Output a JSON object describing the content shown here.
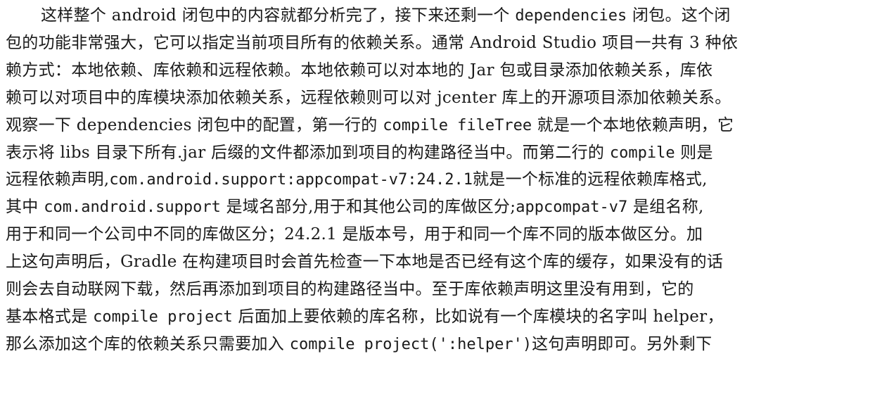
{
  "paragraph": {
    "lines": [
      [
        {
          "t": "这样整个 android 闭包中的内容就都分析完了，接下来还剩一个 "
        },
        {
          "t": "dependencies",
          "code": true
        },
        {
          "t": " 闭包。这个闭"
        }
      ],
      [
        {
          "t": "包的功能非常强大，它可以指定当前项目所有的依赖关系。通常 Android Studio 项目一共有 3 种依"
        }
      ],
      [
        {
          "t": "赖方式：本地依赖、库依赖和远程依赖。本地依赖可以对本地的 Jar 包或目录添加依赖关系，库依"
        }
      ],
      [
        {
          "t": "赖可以对项目中的库模块添加依赖关系，远程依赖则可以对 jcenter 库上的开源项目添加依赖关系。"
        }
      ],
      [
        {
          "t": "观察一下 dependencies 闭包中的配置，第一行的 "
        },
        {
          "t": "compile fileTree",
          "code": true
        },
        {
          "t": " 就是一个本地依赖声明，它"
        }
      ],
      [
        {
          "t": "表示将 libs 目录下所有.jar 后缀的文件都添加到项目的构建路径当中。而第二行的 "
        },
        {
          "t": "compile",
          "code": true
        },
        {
          "t": " 则是"
        }
      ],
      [
        {
          "t": "远程依赖声明,"
        },
        {
          "t": "com.android.support:appcompat-v7:24.2.1",
          "code": true
        },
        {
          "t": "就是一个标准的远程依赖库格式,"
        }
      ],
      [
        {
          "t": "其中 "
        },
        {
          "t": "com.android.support",
          "code": true
        },
        {
          "t": " 是域名部分,用于和其他公司的库做区分;"
        },
        {
          "t": "appcompat-v7",
          "code": true
        },
        {
          "t": " 是组名称,"
        }
      ],
      [
        {
          "t": "用于和同一个公司中不同的库做区分；24.2.1 是版本号，用于和同一个库不同的版本做区分。加"
        }
      ],
      [
        {
          "t": "上这句声明后，Gradle 在构建项目时会首先检查一下本地是否已经有这个库的缓存，如果没有的话"
        }
      ],
      [
        {
          "t": "则会去自动联网下载，然后再添加到项目的构建路径当中。至于库依赖声明这里没有用到，它的"
        }
      ],
      [
        {
          "t": "基本格式是 "
        },
        {
          "t": "compile project",
          "code": true
        },
        {
          "t": " 后面加上要依赖的库名称，比如说有一个库模块的名字叫 helper，"
        }
      ],
      [
        {
          "t": "那么添加这个库的依赖关系只需要加入 "
        },
        {
          "t": "compile project(':helper')",
          "code": true
        },
        {
          "t": "这句声明即可。另外剩下"
        }
      ]
    ]
  }
}
